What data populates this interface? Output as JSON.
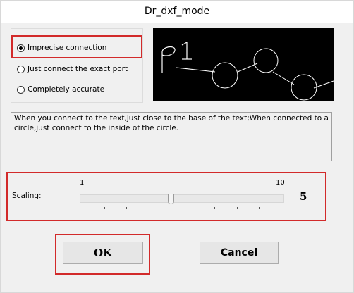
{
  "window": {
    "title": "Dr_dxf_mode"
  },
  "options": {
    "items": [
      {
        "label": "Imprecise connection",
        "selected": true
      },
      {
        "label": "Just connect the exact port",
        "selected": false
      },
      {
        "label": "Completely accurate",
        "selected": false
      }
    ]
  },
  "preview": {
    "text": "p1"
  },
  "description": {
    "text": "When you connect to the text,just close to the base of the text;When connected to a circle,just connect to the inside of the circle."
  },
  "scaling": {
    "label": "Scaling:",
    "min_label": "1",
    "max_label": "10",
    "min": 1,
    "max": 10,
    "value": 5,
    "value_text": "5"
  },
  "buttons": {
    "ok": "OK",
    "cancel": "Cancel"
  },
  "colors": {
    "highlight": "#d22a2a",
    "preview_bg": "#000000",
    "preview_fg": "#ffffff"
  }
}
